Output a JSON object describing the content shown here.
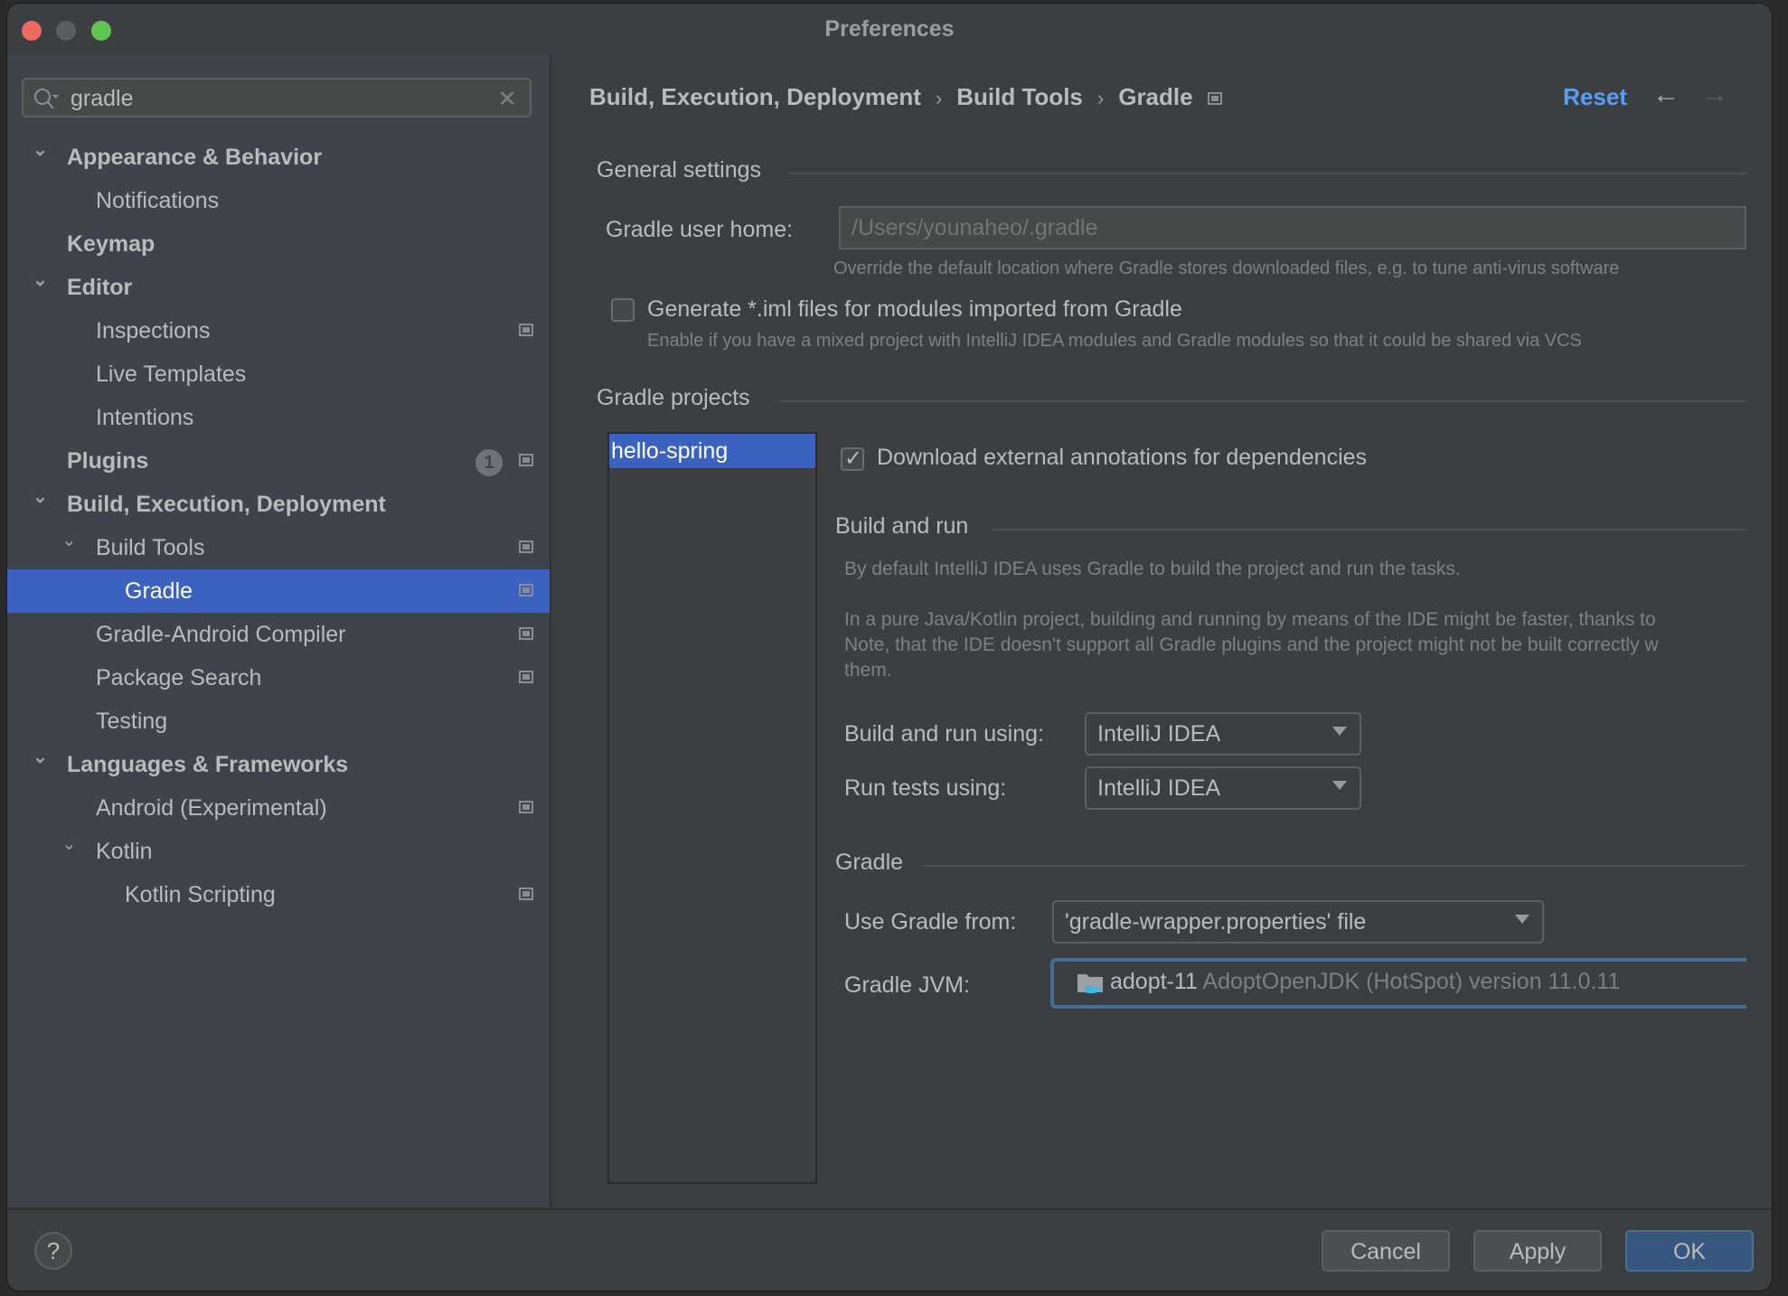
{
  "window": {
    "title": "Preferences"
  },
  "search": {
    "value": "gradle",
    "clear_icon": "close-icon"
  },
  "sidebar": {
    "items": [
      {
        "label": "Appearance & Behavior",
        "level": 0,
        "bold": true,
        "expanded": true
      },
      {
        "label": "Notifications",
        "level": 1
      },
      {
        "label": "Keymap",
        "level": 0,
        "bold": true
      },
      {
        "label": "Editor",
        "level": 0,
        "bold": true,
        "expanded": true
      },
      {
        "label": "Inspections",
        "level": 1,
        "project_icon": true
      },
      {
        "label": "Live Templates",
        "level": 1
      },
      {
        "label": "Intentions",
        "level": 1
      },
      {
        "label": "Plugins",
        "level": 0,
        "bold": true,
        "badge": "1",
        "project_icon": true
      },
      {
        "label": "Build, Execution, Deployment",
        "level": 0,
        "bold": true,
        "expanded": true
      },
      {
        "label": "Build Tools",
        "level": 1,
        "expanded": true,
        "project_icon": true
      },
      {
        "label": "Gradle",
        "level": 2,
        "selected": true,
        "project_icon": true
      },
      {
        "label": "Gradle-Android Compiler",
        "level": 1,
        "project_icon": true
      },
      {
        "label": "Package Search",
        "level": 1,
        "project_icon": true
      },
      {
        "label": "Testing",
        "level": 1
      },
      {
        "label": "Languages & Frameworks",
        "level": 0,
        "bold": true,
        "expanded": true
      },
      {
        "label": "Android (Experimental)",
        "level": 1,
        "project_icon": true
      },
      {
        "label": "Kotlin",
        "level": 1,
        "expanded": true
      },
      {
        "label": "Kotlin Scripting",
        "level": 2,
        "project_icon": true
      }
    ]
  },
  "breadcrumb": {
    "items": [
      "Build, Execution, Deployment",
      "Build Tools",
      "Gradle"
    ],
    "separator": "›"
  },
  "header": {
    "reset_label": "Reset",
    "back_icon": "←",
    "forward_icon": "→"
  },
  "general": {
    "title": "General settings",
    "user_home_label": "Gradle user home:",
    "user_home_placeholder": "/Users/younaheo/.gradle",
    "user_home_hint": "Override the default location where Gradle stores downloaded files, e.g. to tune anti-virus software",
    "generate_iml_label": "Generate *.iml files for modules imported from Gradle",
    "generate_iml_checked": false,
    "generate_iml_hint": "Enable if you have a mixed project with IntelliJ IDEA modules and Gradle modules so that it could be shared via VCS"
  },
  "projects": {
    "title": "Gradle projects",
    "list": [
      "hello-spring"
    ],
    "download_annotations_label": "Download external annotations for dependencies",
    "download_annotations_checked": true
  },
  "build_run": {
    "title": "Build and run",
    "hint1": "By default IntelliJ IDEA uses Gradle to build the project and run the tasks.",
    "hint2_line1": "In a pure Java/Kotlin project, building and running by means of the IDE might be faster, thanks to",
    "hint2_line2": "Note, that the IDE doesn't support all Gradle plugins and the project might not be built correctly w",
    "hint2_line3": "them.",
    "build_using_label": "Build and run using:",
    "build_using_value": "IntelliJ IDEA",
    "tests_using_label": "Run tests using:",
    "tests_using_value": "IntelliJ IDEA"
  },
  "gradle": {
    "title": "Gradle",
    "use_from_label": "Use Gradle from:",
    "use_from_value": "'gradle-wrapper.properties' file",
    "jvm_label": "Gradle JVM:",
    "jvm_name": "adopt-11",
    "jvm_desc": "AdoptOpenJDK (HotSpot) version 11.0.11"
  },
  "footer": {
    "help_label": "?",
    "cancel_label": "Cancel",
    "apply_label": "Apply",
    "ok_label": "OK"
  },
  "colors": {
    "accent": "#3b62c1",
    "link": "#589df6",
    "ok_button": "#365880",
    "focus_border": "#466d94"
  }
}
